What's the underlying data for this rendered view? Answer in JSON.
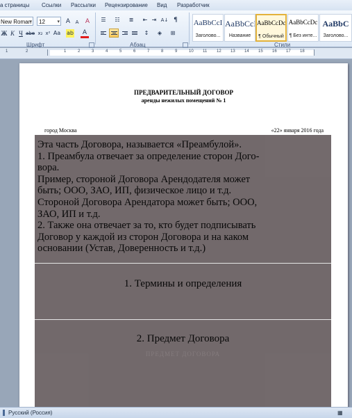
{
  "ribbon_tabs": [
    "а страницы",
    "Ссылки",
    "Рассылки",
    "Рецензирование",
    "Вид",
    "Разработчик"
  ],
  "font": {
    "name": "New Roman",
    "size": "12",
    "group_label": "Шрифт",
    "buttons": {
      "grow": "A",
      "shrink": "A",
      "clear": "A",
      "bold": "Ж",
      "italic": "К",
      "underline": "Ч",
      "strike": "abe",
      "subscript": "x₂",
      "superscript": "x²",
      "case": "Aa",
      "highlight": "ab",
      "color": "A"
    }
  },
  "paragraph": {
    "group_label": "Абзац",
    "sort_icon": "А↓",
    "marks_icon": "¶"
  },
  "styles": {
    "group_label": "Стили",
    "tiles": [
      {
        "sample": "AaBbCcI",
        "name": "Заголово..."
      },
      {
        "sample": "AaBbCcI",
        "name": "Название"
      },
      {
        "sample": "AaBbCcDc",
        "name": "¶ Обычный"
      },
      {
        "sample": "AaBbCcDc",
        "name": "¶ Без инте..."
      },
      {
        "sample": "AaBbC",
        "name": "Заголово..."
      }
    ]
  },
  "ruler": {
    "numbers": [
      "1",
      "2",
      "1",
      "2",
      "3",
      "4",
      "5",
      "6",
      "7",
      "8",
      "9",
      "10",
      "11",
      "12",
      "13",
      "14",
      "15",
      "16",
      "17",
      "18"
    ]
  },
  "document": {
    "title": "ПРЕДВАРИТЕЛЬНЫЙ ДОГОВОР",
    "subtitle": "аренды нежилых помещений № 1",
    "city": "город Москва",
    "date": "«22» января 2016 года",
    "overlay_lines": [
      "Эта часть Договора, называется «Преамбулой».",
      "1. Преамбула отвечает за определение сторон Дого-",
      "вора.",
      "Пример, стороной Договора Арендодателя может",
      "быть; ООО, ЗАО, ИП, физическое лицо и т.д.",
      "Стороной Договора Арендатора может быть; ООО,",
      "ЗАО, ИП и т.д.",
      "2. Также она отвечает за то, кто будет подписывать",
      "Договор у каждой из сторон Договора и на каком",
      "основании (Устав, Доверенность и т.д.)"
    ],
    "section_1": "1. Термины и определения",
    "section_2": "2. Предмет Договора",
    "ghost_text": "ПРЕДМЕТ ДОГОВОРА"
  },
  "statusbar": {
    "language": "Русский (Россия)"
  }
}
